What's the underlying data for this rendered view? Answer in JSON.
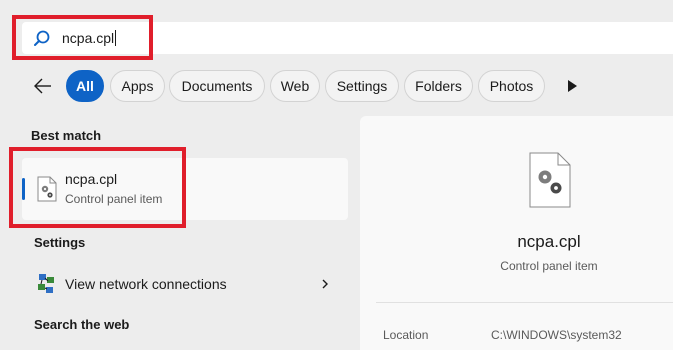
{
  "search": {
    "query": "ncpa.cpl"
  },
  "filters": {
    "items": [
      {
        "label": "All",
        "active": true
      },
      {
        "label": "Apps",
        "active": false
      },
      {
        "label": "Documents",
        "active": false
      },
      {
        "label": "Web",
        "active": false
      },
      {
        "label": "Settings",
        "active": false
      },
      {
        "label": "Folders",
        "active": false
      },
      {
        "label": "Photos",
        "active": false
      }
    ]
  },
  "results": {
    "best_match_header": "Best match",
    "best_match": {
      "title": "ncpa.cpl",
      "subtitle": "Control panel item"
    },
    "settings_header": "Settings",
    "settings_items": [
      {
        "label": "View network connections"
      }
    ],
    "web_header": "Search the web"
  },
  "preview": {
    "title": "ncpa.cpl",
    "subtitle": "Control panel item",
    "properties": [
      {
        "label": "Location",
        "value": "C:\\WINDOWS\\system32"
      }
    ]
  },
  "colors": {
    "accent": "#0e63c6",
    "highlight": "#e01e2b"
  }
}
